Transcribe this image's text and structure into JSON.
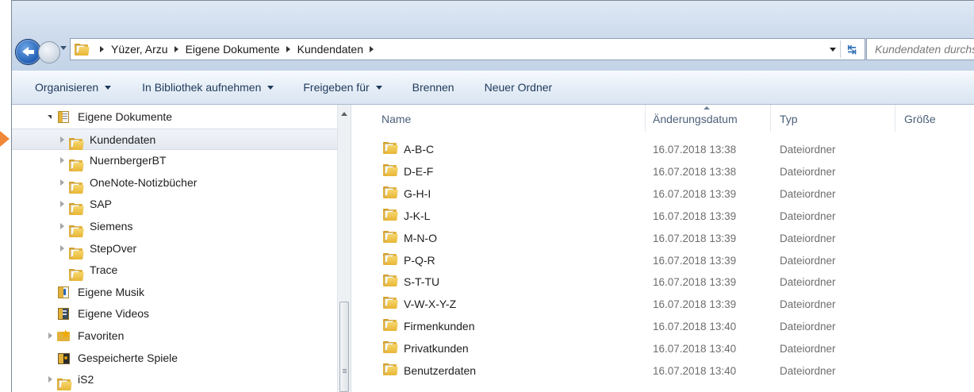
{
  "address": {
    "crumbs": [
      "Yüzer, Arzu",
      "Eigene Dokumente",
      "Kundendaten"
    ],
    "search_placeholder": "Kundendaten durchsuchen"
  },
  "toolbar": {
    "organize": "Organisieren",
    "library": "In Bibliothek aufnehmen",
    "share": "Freigeben für",
    "burn": "Brennen",
    "new_folder": "Neuer Ordner"
  },
  "tree": [
    {
      "label": "Eigene Dokumente",
      "level": 0,
      "expander": "open",
      "icon": "documents-library-icon"
    },
    {
      "label": "Kundendaten",
      "level": 1,
      "expander": "closed",
      "icon": "folder-icon",
      "selected": true
    },
    {
      "label": "NuernbergerBT",
      "level": 1,
      "expander": "closed",
      "icon": "folder-icon"
    },
    {
      "label": "OneNote-Notizbücher",
      "level": 1,
      "expander": "closed",
      "icon": "folder-icon"
    },
    {
      "label": "SAP",
      "level": 1,
      "expander": "closed",
      "icon": "folder-icon"
    },
    {
      "label": "Siemens",
      "level": 1,
      "expander": "closed",
      "icon": "folder-icon"
    },
    {
      "label": "StepOver",
      "level": 1,
      "expander": "closed",
      "icon": "folder-icon"
    },
    {
      "label": "Trace",
      "level": 1,
      "expander": "none",
      "icon": "folder-icon"
    },
    {
      "label": "Eigene Musik",
      "level": 0,
      "expander": "none",
      "icon": "music-folder-icon"
    },
    {
      "label": "Eigene Videos",
      "level": 0,
      "expander": "none",
      "icon": "videos-folder-icon"
    },
    {
      "label": "Favoriten",
      "level": 0,
      "expander": "closed",
      "icon": "favorites-star-icon"
    },
    {
      "label": "Gespeicherte Spiele",
      "level": 0,
      "expander": "none",
      "icon": "saved-games-icon"
    },
    {
      "label": "iS2",
      "level": 0,
      "expander": "closed",
      "icon": "folder-icon"
    }
  ],
  "columns": {
    "name": "Name",
    "modified": "Änderungsdatum",
    "type": "Typ",
    "size": "Größe"
  },
  "files": [
    {
      "name": "A-B-C",
      "modified": "16.07.2018 13:38",
      "type": "Dateiordner"
    },
    {
      "name": "D-E-F",
      "modified": "16.07.2018 13:38",
      "type": "Dateiordner"
    },
    {
      "name": "G-H-I",
      "modified": "16.07.2018 13:39",
      "type": "Dateiordner"
    },
    {
      "name": "J-K-L",
      "modified": "16.07.2018 13:39",
      "type": "Dateiordner"
    },
    {
      "name": "M-N-O",
      "modified": "16.07.2018 13:39",
      "type": "Dateiordner"
    },
    {
      "name": "P-Q-R",
      "modified": "16.07.2018 13:39",
      "type": "Dateiordner"
    },
    {
      "name": "S-T-TU",
      "modified": "16.07.2018 13:39",
      "type": "Dateiordner"
    },
    {
      "name": "V-W-X-Y-Z",
      "modified": "16.07.2018 13:39",
      "type": "Dateiordner"
    },
    {
      "name": "Firmenkunden",
      "modified": "16.07.2018 13:40",
      "type": "Dateiordner"
    },
    {
      "name": "Privatkunden",
      "modified": "16.07.2018 13:40",
      "type": "Dateiordner"
    },
    {
      "name": "Benutzerdaten",
      "modified": "16.07.2018 13:40",
      "type": "Dateiordner"
    }
  ],
  "colors": {
    "accent_arrow": "#f0883a",
    "toolbar_text": "#1e395b",
    "folder": "#e2b23c"
  }
}
